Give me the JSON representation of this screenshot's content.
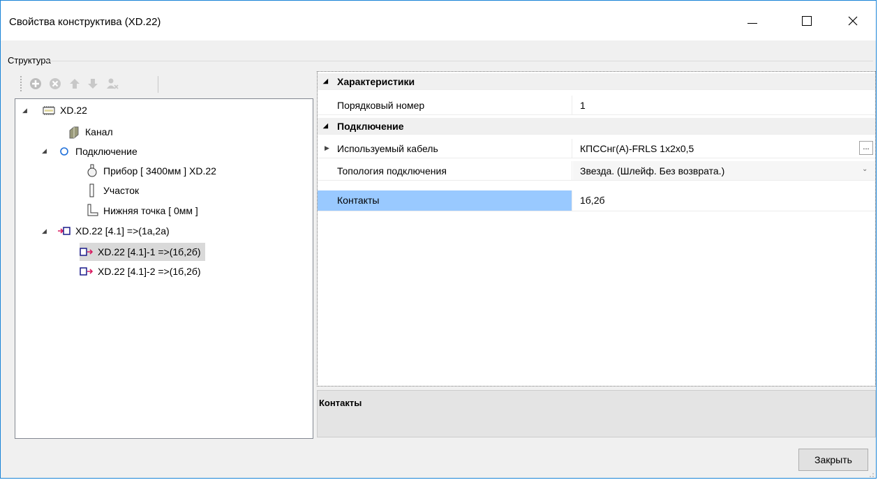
{
  "window": {
    "title": "Свойства конструктива (XD.22)"
  },
  "group": {
    "label": "Структура"
  },
  "tree": {
    "nodes": [
      {
        "label": "XD.22"
      },
      {
        "label": "Канал"
      },
      {
        "label": "Подключение"
      },
      {
        "label": "Прибор [ 3400мм ] XD.22"
      },
      {
        "label": "Участок"
      },
      {
        "label": "Нижняя точка [ 0мм ]"
      },
      {
        "label": "XD.22 [4.1] =>(1а,2а)"
      },
      {
        "label": "XD.22 [4.1]-1 =>(1б,2б)"
      },
      {
        "label": "XD.22 [4.1]-2 =>(1б,2б)"
      }
    ]
  },
  "grid": {
    "categories": [
      {
        "label": "Характеристики"
      },
      {
        "label": "Подключение"
      }
    ],
    "props": [
      {
        "name": "Порядковый номер",
        "value": "1"
      },
      {
        "name": "Используемый кабель",
        "value": "КПССнг(А)-FRLS 1x2x0,5",
        "button": "..."
      },
      {
        "name": "Топология подключения",
        "value": "Звезда. (Шлейф. Без возврата.)"
      },
      {
        "name": "Контакты",
        "value": "1б,2б"
      }
    ]
  },
  "description": {
    "title": "Контакты"
  },
  "buttons": {
    "close": "Закрыть"
  },
  "colors": {
    "selection": "#99c9ff",
    "window_border": "#1883d7"
  }
}
